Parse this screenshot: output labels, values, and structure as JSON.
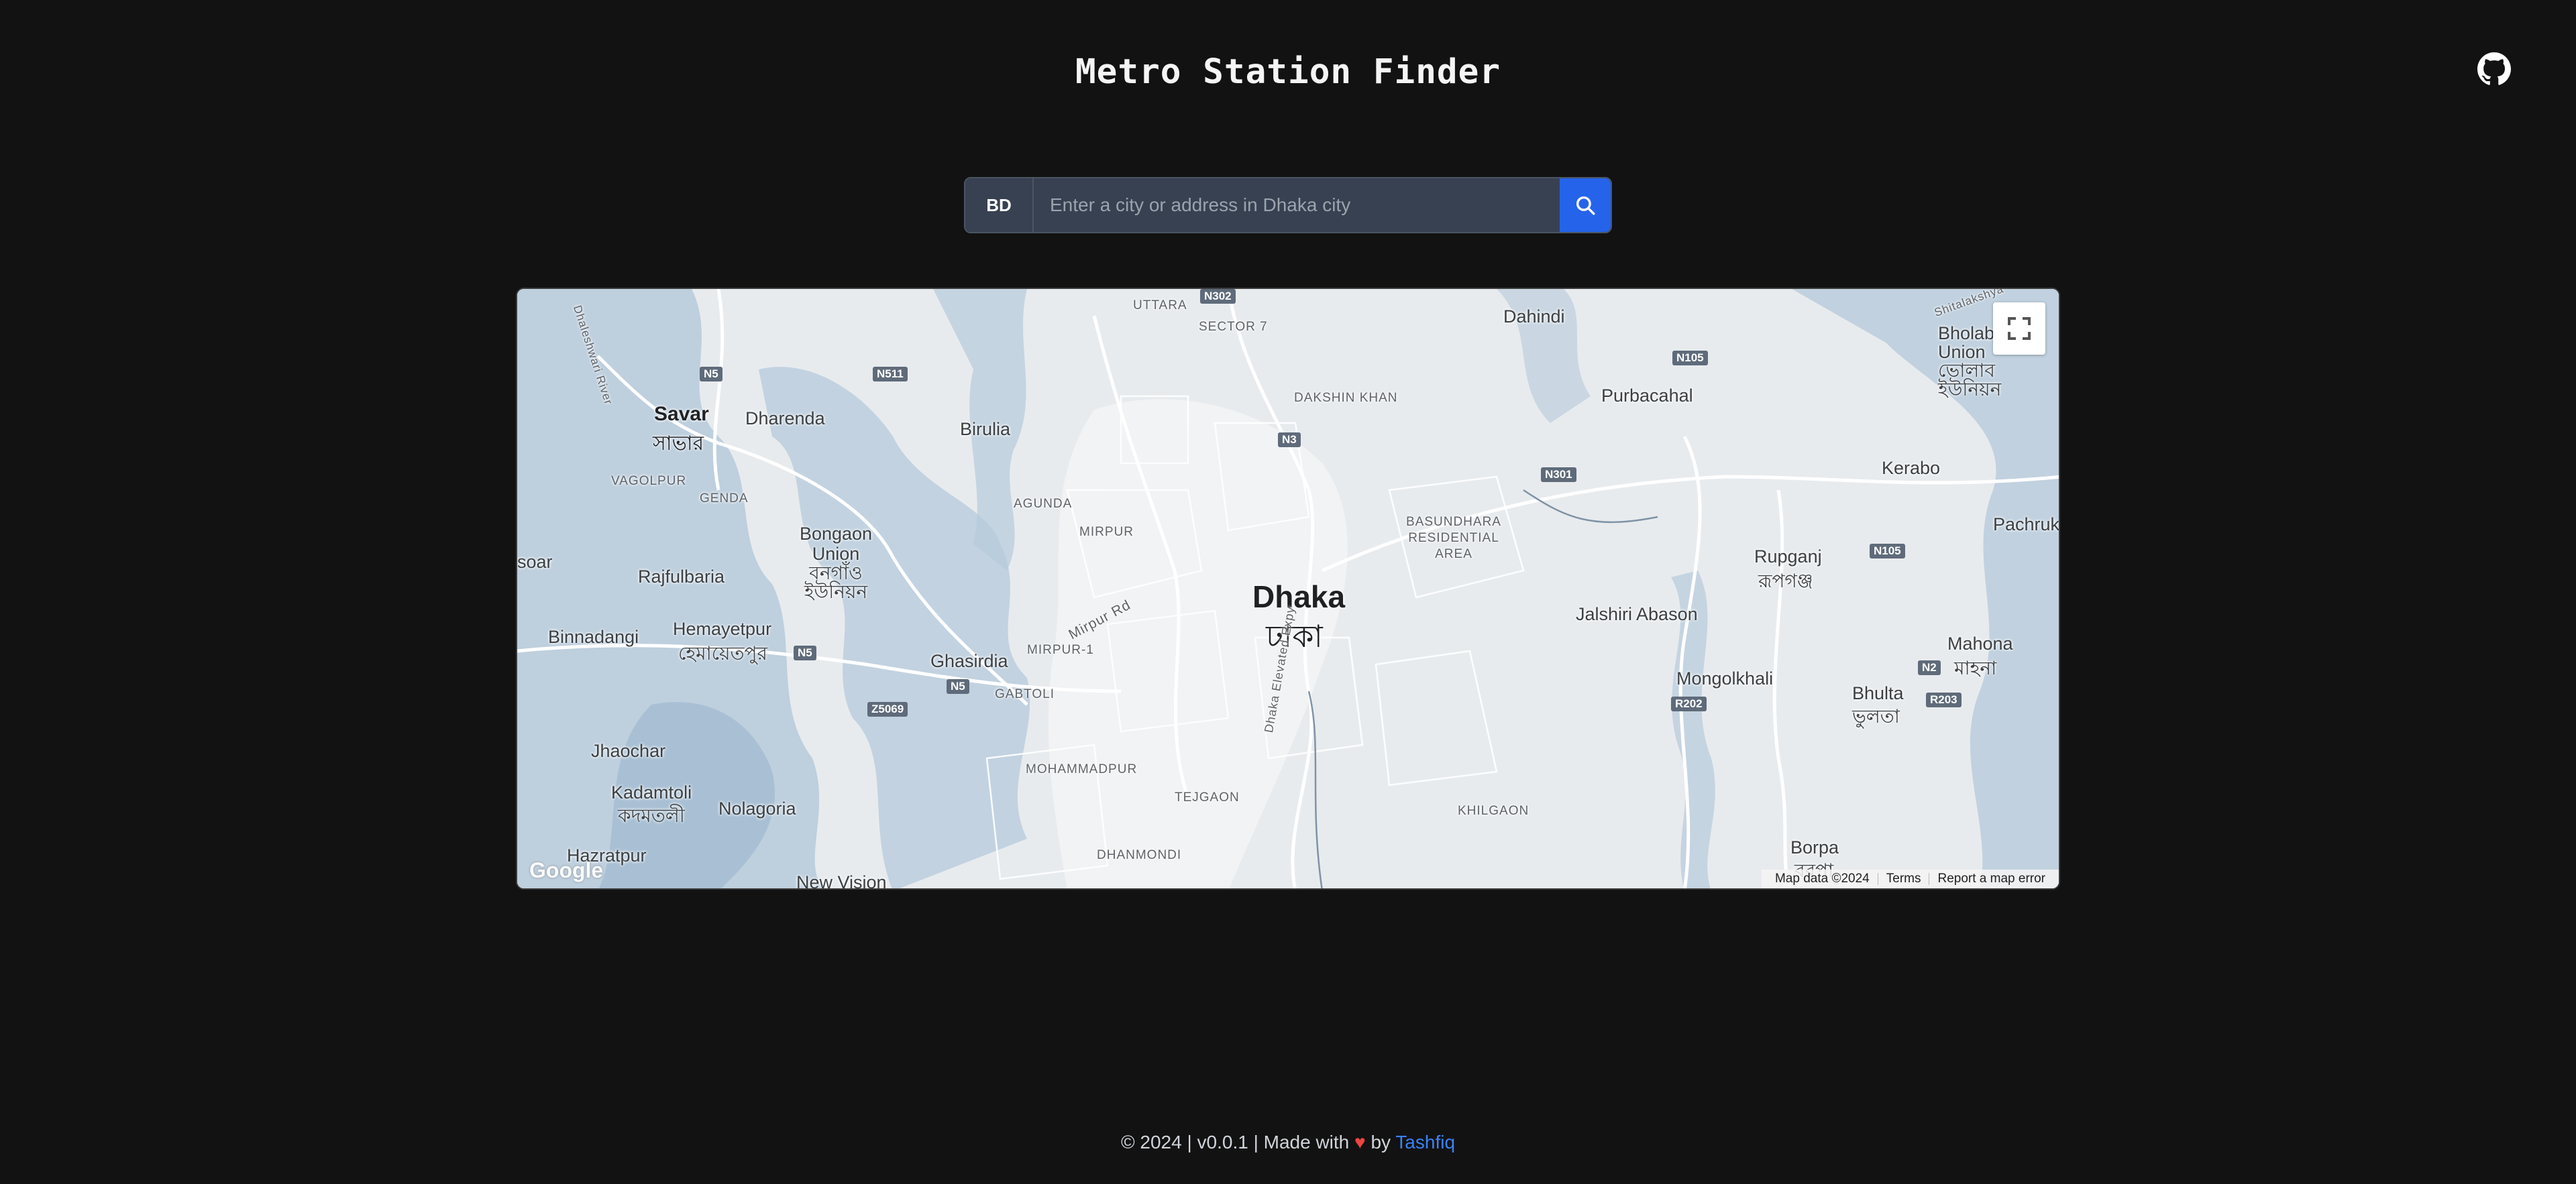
{
  "header": {
    "title": "Metro Station Finder"
  },
  "search": {
    "country_code": "BD",
    "placeholder": "Enter a city or address in Dhaka city",
    "value": ""
  },
  "map": {
    "labels": {
      "dhaka": "Dhaka",
      "dhaka_bn": "ঢাকা",
      "savar": "Savar",
      "savar_bn": "সাভার",
      "dharenda": "Dharenda",
      "birulia": "Birulia",
      "uttara": "UTTARA",
      "sector7": "SECTOR 7",
      "dakshin_khan": "DAKSHIN KHAN",
      "dahindi": "Dahindi",
      "purbacahal": "Purbacahal",
      "bholab_union": "Bholab Union",
      "bholab_bn": "ভোলাব ইউনিয়ন",
      "vagolpur": "VAGOLPUR",
      "genda": "GENDA",
      "agunda": "AGUNDA",
      "mirpur": "MIRPUR",
      "bashundhara": "BASUNDHARA RESIDENTIAL AREA",
      "kerabo": "Kerabo",
      "pachruk": "Pachruk",
      "bongaon": "Bongaon Union",
      "bongaon_bn": "বনগাঁও ইউনিয়ন",
      "rajfulbaria": "Rajfulbaria",
      "rupganj": "Rupganj",
      "rupganj_bn": "রূপগঞ্জ",
      "binnadangi": "Binnadangi",
      "hemayetpur": "Hemayetpur",
      "hemayetpur_bn": "হেমায়েতপুর",
      "ghasirdia": "Ghasirdia",
      "mirpur1": "MIRPUR-1",
      "mirpur_rd": "Mirpur Rd",
      "jalshiri": "Jalshiri Abason",
      "mahona": "Mahona",
      "mahona_bn": "মাহনা",
      "gabtoli": "GABTOLI",
      "mongolkhali": "Mongolkhali",
      "bhulta": "Bhulta",
      "bhulta_bn": "ভুলতা",
      "jhaochar": "Jhaochar",
      "mohammadpur": "MOHAMMADPUR",
      "kadamtoli": "Kadamtoli",
      "kadamtoli_bn": "কদমতলী",
      "tejgaon": "TEJGAON",
      "nolagoria": "Nolagoria",
      "khilgaon": "KHILGAON",
      "hazratpur": "Hazratpur",
      "dhanmondi": "DHANMONDI",
      "borpa": "Borpa",
      "borpa_bn": "বরপা",
      "new_vision": "New Vision",
      "dhaka_expy": "Dhaka Elevated Expy",
      "soar": "soar",
      "shitalakshya": "Shitalakshya",
      "dhaleshwari": "Dhaleshwari River"
    },
    "roads": {
      "n5a": "N5",
      "n5b": "N5",
      "n5c": "N5",
      "n511": "N511",
      "n302": "N302",
      "n3": "N3",
      "n105a": "N105",
      "n105b": "N105",
      "n301": "N301",
      "z5069": "Z5069",
      "n2": "N2",
      "r202": "R202",
      "r203": "R203"
    },
    "attribution": {
      "data": "Map data ©2024",
      "terms": "Terms",
      "report": "Report a map error",
      "google": "Google"
    }
  },
  "footer": {
    "prefix": "© 2024 | v0.0.1 | Made with",
    "by": "by",
    "author": "Tashfiq"
  },
  "colors": {
    "background": "#121212",
    "accent": "#2563eb",
    "link": "#3b82f6",
    "heart": "#ef4444",
    "water": "#b6cadb",
    "land": "#e8ebee"
  }
}
